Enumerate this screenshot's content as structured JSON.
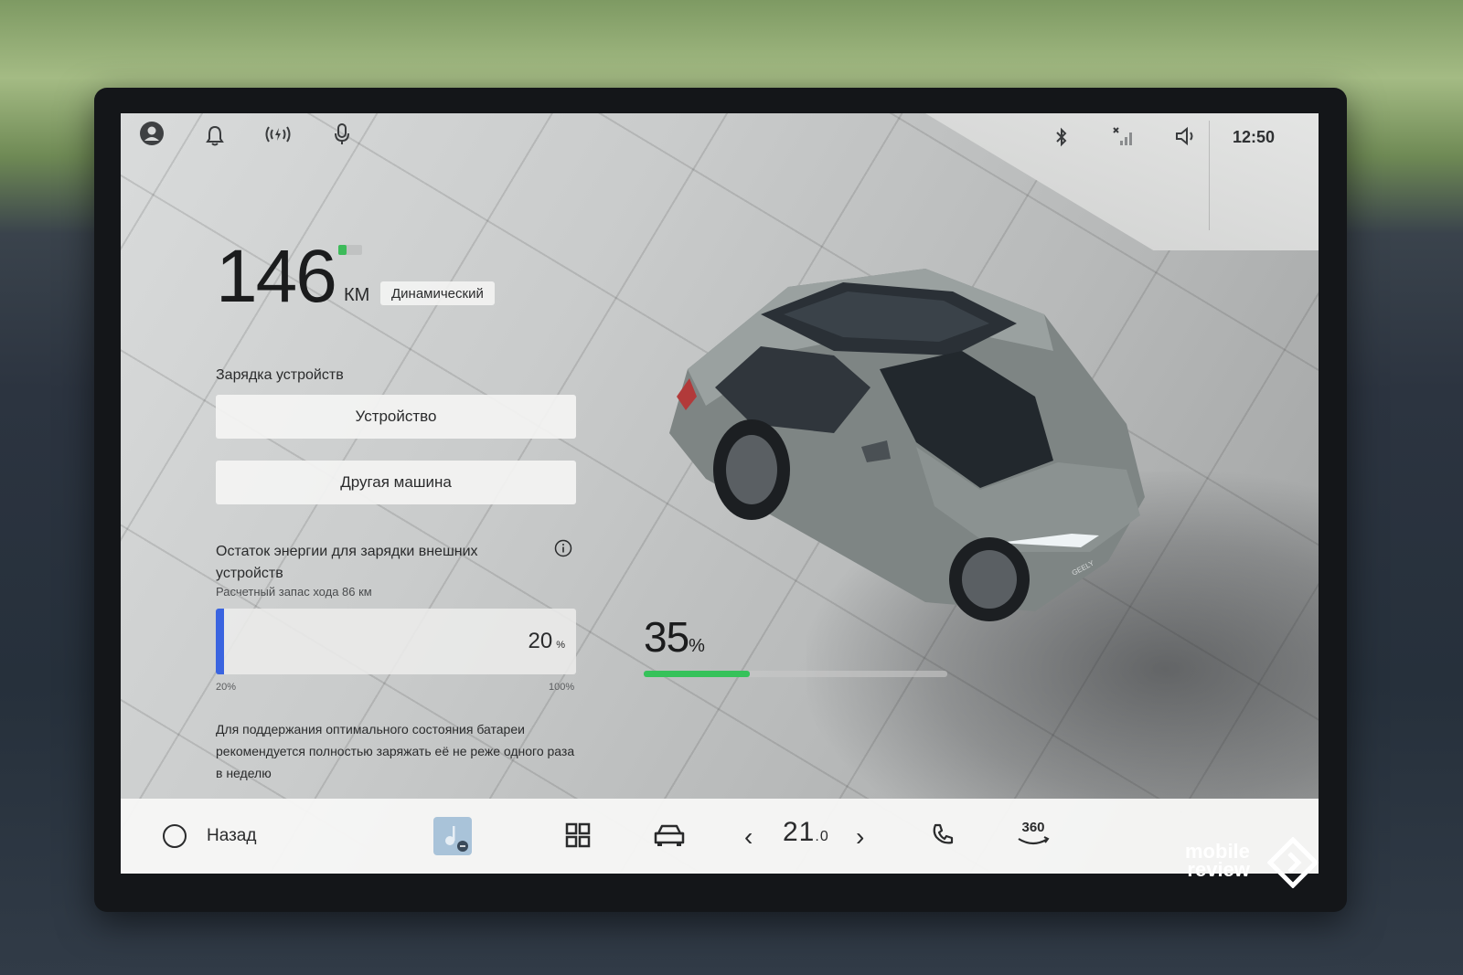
{
  "status_bar": {
    "icons": [
      "user-icon",
      "bell-icon",
      "wireless-charging-icon",
      "microphone-icon",
      "bluetooth-icon",
      "no-signal-icon",
      "volume-icon"
    ],
    "time": "12:50"
  },
  "range": {
    "value": "146",
    "unit": "КМ",
    "drive_mode": "Динамический",
    "battery_level_fraction": 0.35
  },
  "device_charging": {
    "title": "Зарядка устройств",
    "device_button": "Устройство",
    "other_car_button": "Другая машина"
  },
  "energy_reserve": {
    "title": "Остаток энергии для зарядки внешних устройств",
    "subtitle": "Расчетный запас хода 86 км",
    "value": "20",
    "unit": "%",
    "min_label": "20%",
    "max_label": "100%",
    "fill_fraction": 0.0
  },
  "note": "Для поддержания оптимального состояния батареи рекомендуется полностью заряжать её не реже одного раза в неделю",
  "soc": {
    "value": "35",
    "unit": "%",
    "fraction": 0.35,
    "color": "#36c25a"
  },
  "car": {
    "brand_badge": "GEELY"
  },
  "dock": {
    "back_label": "Назад",
    "temperature_int": "21",
    "temperature_dec": ".0",
    "view_360": "360"
  },
  "watermark": {
    "line1": "mobile",
    "line2": "review"
  },
  "colors": {
    "accent_blue": "#3a64e0",
    "soc_green": "#36c25a"
  }
}
